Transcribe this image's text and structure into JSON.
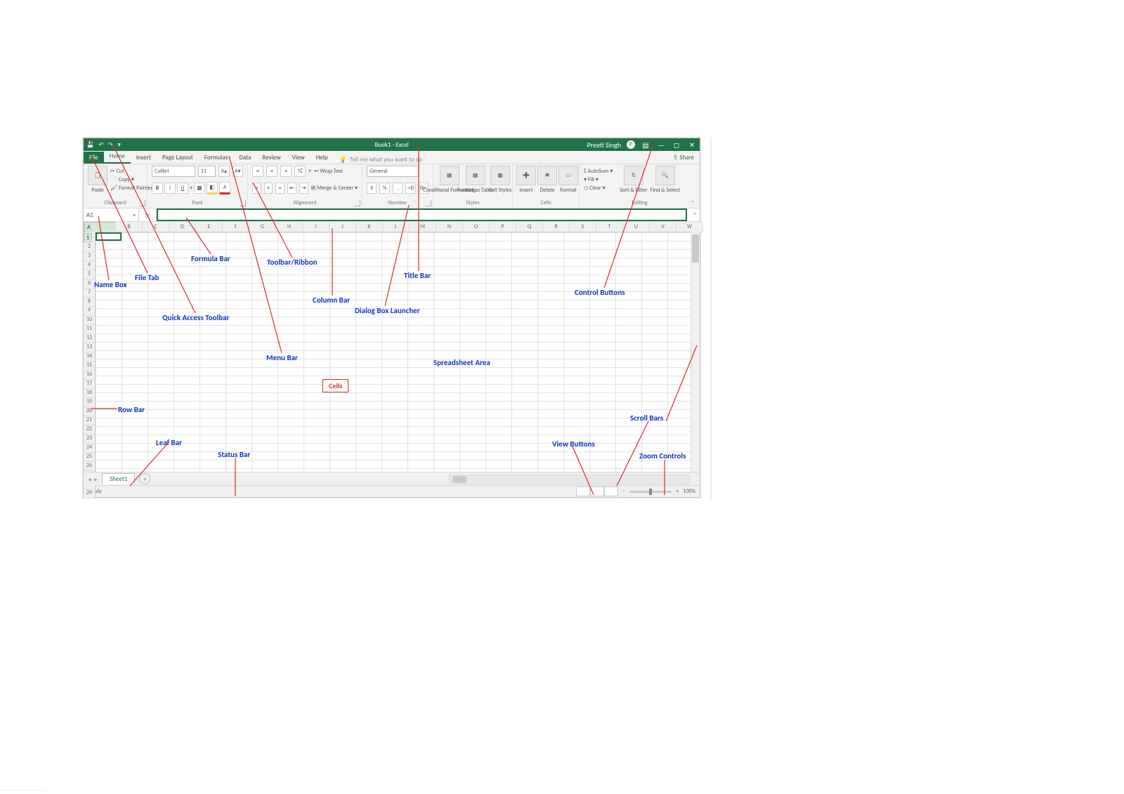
{
  "titlebar": {
    "doc_title": "Book1 - Excel",
    "user": "Preeti Singh",
    "qa_save_icon": "💾",
    "qa_undo_icon": "↶",
    "qa_redo_icon": "↷",
    "ribbon_display_icon": "▤",
    "minimize_icon": "—",
    "maximize_icon": "◻",
    "close_icon": "✕"
  },
  "tabs": {
    "file": "File",
    "home": "Home",
    "insert": "Insert",
    "pagelayout": "Page Layout",
    "formulas": "Formulas",
    "data": "Data",
    "review": "Review",
    "view": "View",
    "help": "Help",
    "tellme_icon": "💡",
    "tellme": "Tell me what you want to do",
    "share": "Share",
    "share_icon": "⇪"
  },
  "ribbon": {
    "clipboard": {
      "label": "Clipboard",
      "paste": "Paste",
      "cut": "Cut",
      "copy": "Copy",
      "format_painter": "Format Painter",
      "cut_icon": "✂"
    },
    "font": {
      "label": "Font",
      "family": "Calibri",
      "size": "11",
      "bold": "B",
      "italic": "I",
      "underline": "U",
      "grow": "A▴",
      "shrink": "A▾",
      "border_icon": "▦",
      "fill_icon": "◧",
      "color_icon": "A"
    },
    "alignment": {
      "label": "Alignment",
      "wrap": "Wrap Text",
      "merge": "Merge & Center"
    },
    "number": {
      "label": "Number",
      "format": "General",
      "currency_icon": "$",
      "percent_icon": "%",
      "comma_icon": ",",
      "inc_dec": "◅0",
      "dec_dec": "0▻"
    },
    "styles": {
      "label": "Styles",
      "cond": "Conditional Formatting",
      "table": "Format as Table",
      "cell": "Cell Styles"
    },
    "cells": {
      "label": "Cells",
      "insert": "Insert",
      "delete": "Delete",
      "format": "Format"
    },
    "editing": {
      "label": "Editing",
      "autosum": "AutoSum",
      "autosum_icon": "Σ",
      "fill": "Fill",
      "fill_icon": "▾",
      "clear": "Clear",
      "clear_icon": "◇",
      "sort": "Sort & Filter",
      "find": "Find & Select"
    }
  },
  "namebox": {
    "value": "A1",
    "fx": "fx"
  },
  "columns": [
    "A",
    "B",
    "C",
    "D",
    "E",
    "F",
    "G",
    "H",
    "I",
    "J",
    "K",
    "L",
    "M",
    "N",
    "O",
    "P",
    "Q",
    "R",
    "S",
    "T",
    "U",
    "V",
    "W"
  ],
  "rows_count": 29,
  "sheet": {
    "tab": "Sheet1",
    "add": "+"
  },
  "status": {
    "ready": "Ready",
    "zoom": "100%",
    "zoom_minus": "−",
    "zoom_plus": "+"
  },
  "annotations": {
    "formula_bar": "Formula Bar",
    "toolbar_ribbon": "Toolbar/Ribbon",
    "title_bar": "Title Bar",
    "control_buttons": "Control Buttons",
    "file_tab": "File Tab",
    "name_box": "Name Box",
    "quick_access": "Quick Access Toolbar",
    "column_bar": "Column Bar",
    "dialog_launcher": "Dialog Box Launcher",
    "menu_bar": "Menu Bar",
    "spreadsheet_area": "Spreadsheet Area",
    "cells": "Cells",
    "row_bar": "Row Bar",
    "leaf_bar": "Leaf Bar",
    "status_bar": "Status Bar",
    "view_buttons": "View Buttons",
    "zoom_controls": "Zoom Controls",
    "scroll_bars": "Scroll Bars"
  }
}
